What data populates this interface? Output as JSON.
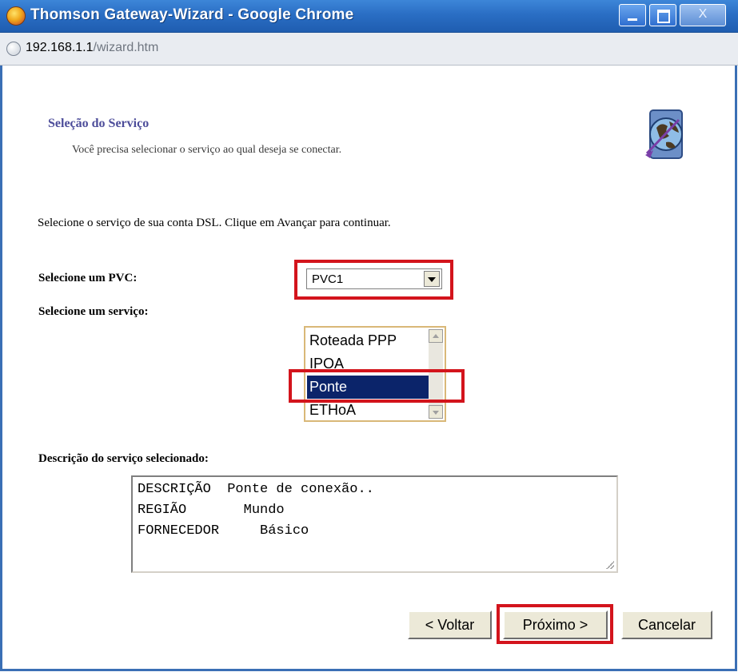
{
  "window": {
    "title": "Thomson Gateway-Wizard - Google Chrome",
    "close_glyph": "X"
  },
  "address": {
    "host": "192.168.1.1",
    "path": "/wizard.htm"
  },
  "page": {
    "heading": "Seleção do Serviço",
    "subheading": "Você precisa selecionar o serviço ao qual deseja se conectar.",
    "instruction": "Selecione o serviço de sua conta DSL. Clique em Avançar para continuar.",
    "pvc_label": "Selecione um PVC:",
    "pvc_value": "PVC1",
    "service_label": "Selecione um serviço:",
    "services": [
      "Roteada PPP",
      "IPOA",
      "Ponte",
      "ETHoA"
    ],
    "selected_service": "Ponte",
    "description_label": "Descrição do serviço selecionado:",
    "description_lines": [
      "DESCRIÇÃO  Ponte de conexão..",
      "REGIÃO       Mundo",
      "FORNECEDOR     Básico"
    ]
  },
  "buttons": {
    "back": "< Voltar",
    "next": "Próximo >",
    "cancel": "Cancelar"
  },
  "colors": {
    "highlight": "#d3141c",
    "selection": "#0b246a",
    "heading": "#4d4d9a",
    "titlebar": "#2a6ec4"
  },
  "icons": [
    "app-icon",
    "globe-icon",
    "globe-logo-icon",
    "dropdown-arrow-icon",
    "scroll-up-icon",
    "scroll-down-icon",
    "resize-grip-icon"
  ]
}
